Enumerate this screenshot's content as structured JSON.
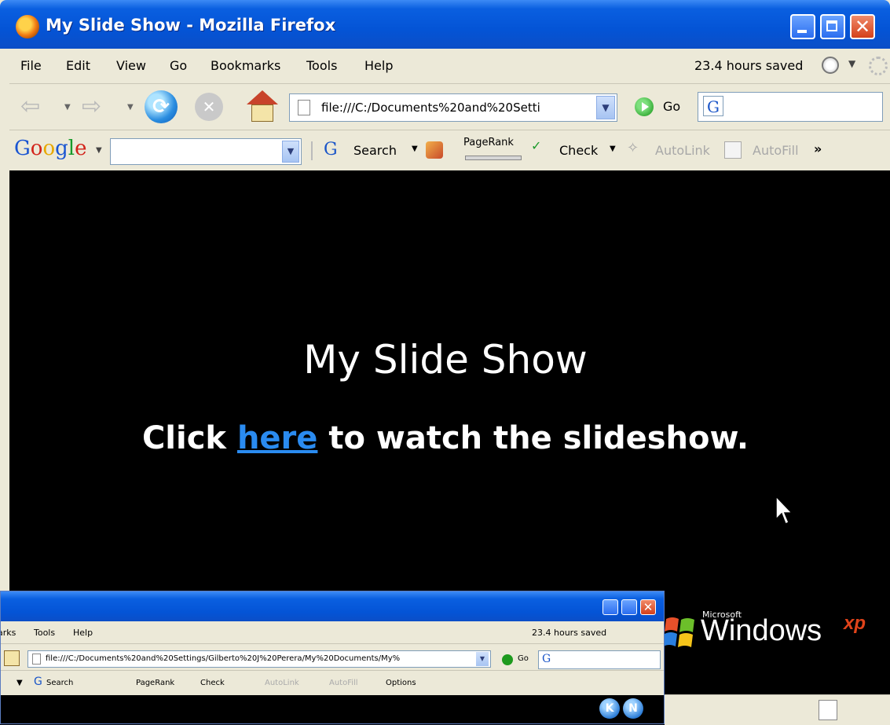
{
  "window": {
    "title": "My Slide Show - Mozilla Firefox"
  },
  "menu": {
    "items": [
      "File",
      "Edit",
      "View",
      "Go",
      "Bookmarks",
      "Tools",
      "Help"
    ],
    "hours_saved": "23.4 hours saved"
  },
  "nav": {
    "url": "file:///C:/Documents%20and%20Setti",
    "go_label": "Go"
  },
  "google_toolbar": {
    "logo_letters": [
      "G",
      "o",
      "o",
      "g",
      "l",
      "e"
    ],
    "search_label": "Search",
    "pagerank_label": "PageRank",
    "check_label": "Check",
    "autolink_label": "AutoLink",
    "autofill_label": "AutoFill",
    "more": "»"
  },
  "page": {
    "heading": "My Slide Show",
    "line_prefix": "Click ",
    "link_text": "here",
    "line_suffix": " to watch the slideshow."
  },
  "branding": {
    "microsoft": "Microsoft",
    "windows": "Windows",
    "xp": "xp"
  },
  "mini_window": {
    "menu_items": [
      "arks",
      "Tools",
      "Help"
    ],
    "hours_saved": "23.4 hours saved",
    "url": "file:///C:/Documents%20and%20Settings/Gilberto%20J%20Perera/My%20Documents/My%",
    "go_label": "Go",
    "search_label": "Search",
    "pagerank_label": "PageRank",
    "check_label": "Check",
    "autolink_label": "AutoLink",
    "autofill_label": "AutoFill",
    "options_label": "Options",
    "nav_buttons": [
      "K",
      "N"
    ]
  },
  "colors": {
    "titlebar": "#0454d6",
    "link": "#2a8bf0",
    "chrome": "#ece9d8"
  }
}
